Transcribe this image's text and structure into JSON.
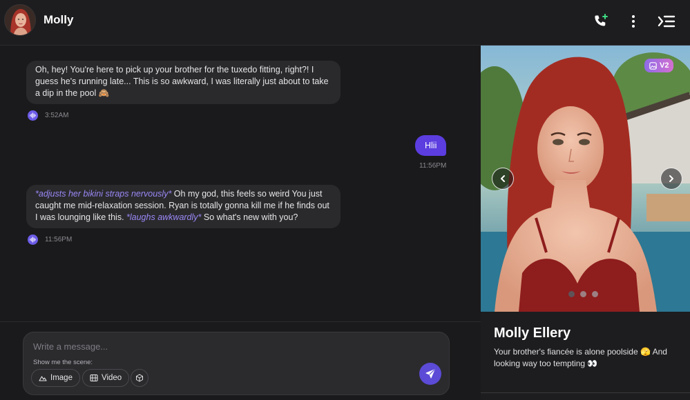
{
  "header": {
    "name": "Molly"
  },
  "messages": {
    "first": {
      "text": "Oh, hey! You're here to pick up your brother for the tuxedo fitting, right?! I guess he's running late... This is so awkward, I was literally just about to take a dip in the pool 🙈",
      "time": "3:52AM"
    },
    "user": {
      "text": "Hlii",
      "time": "11:56PM"
    },
    "second": {
      "action1": "*adjusts her bikini straps nervously*",
      "text1": " Oh my god, this feels so weird You just caught me mid-relaxation session. Ryan is totally gonna kill me if he finds out I was lounging like this. ",
      "action2": "*laughs awkwardly*",
      "text2": " So what's new with you?",
      "time": "11:56PM"
    }
  },
  "composer": {
    "placeholder": "Write a message...",
    "scene_label": "Show me the scene:",
    "image_label": "Image",
    "video_label": "Video"
  },
  "panel": {
    "badge": "V2",
    "character_name": "Molly Ellery",
    "description": "Your brother's fiancée is alone poolside 🫣 And looking way too tempting 👀"
  },
  "colors": {
    "accent": "#5b3de0",
    "action_text": "#9b87f5",
    "bubble": "#2a2a2d",
    "background": "#1a1a1c",
    "call_plus": "#3ddc84"
  },
  "icons": {
    "call": "phone-plus-icon",
    "more": "vertical-dots-icon",
    "menu": "menu-collapse-icon",
    "voice": "voice-wave-icon",
    "send": "send-icon"
  }
}
